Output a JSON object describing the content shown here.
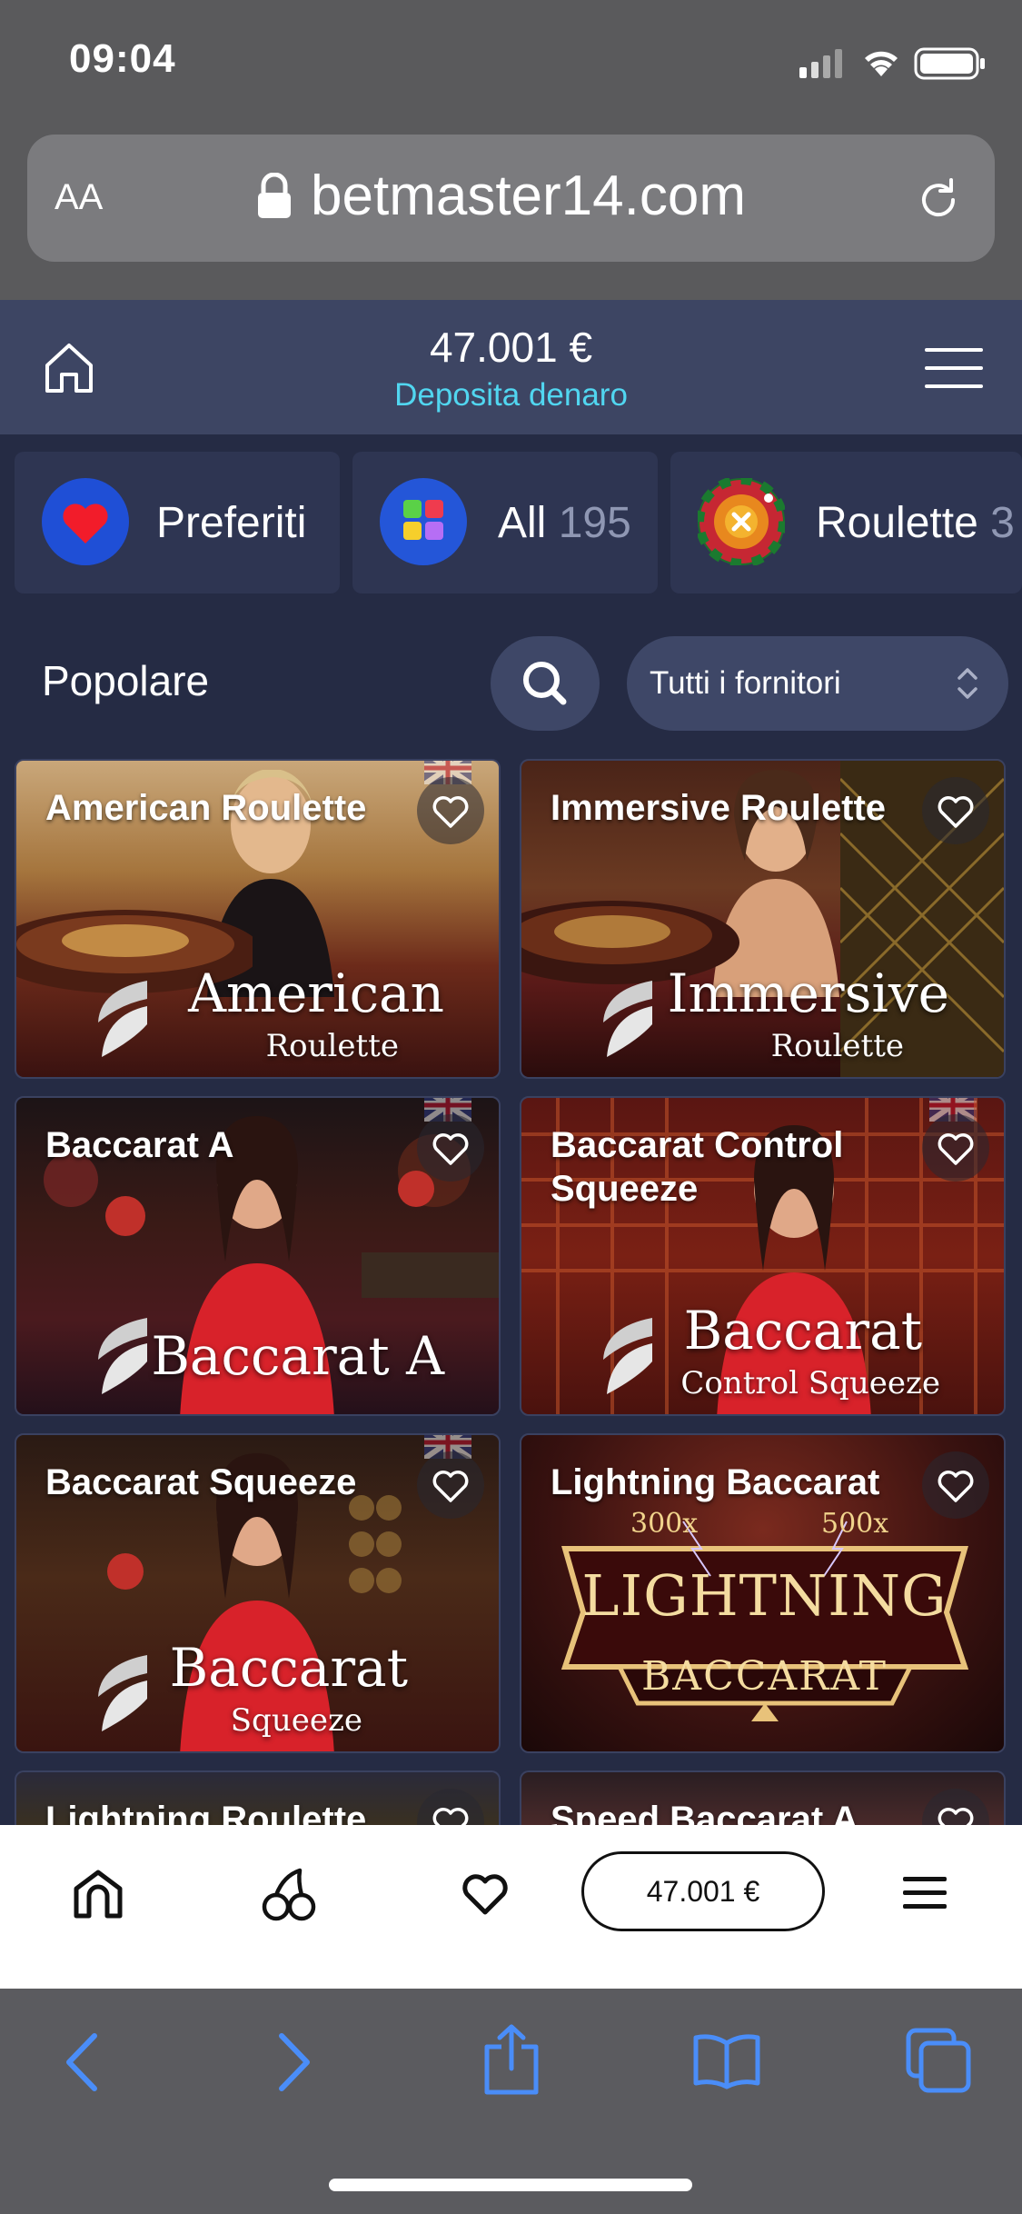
{
  "status_bar": {
    "time": "09:04"
  },
  "browser": {
    "aa_label": "AA",
    "url": "betmaster14.com"
  },
  "header": {
    "balance": "47.001 €",
    "deposit_link": "Deposita denaro"
  },
  "categories": [
    {
      "label": "Preferiti",
      "count": ""
    },
    {
      "label": "All",
      "count": "195"
    },
    {
      "label": "Roulette",
      "count": "3"
    }
  ],
  "filter": {
    "section_title": "Popolare",
    "provider_select": "Tutti i fornitori"
  },
  "games": [
    {
      "title": "American Roulette",
      "logo": "American",
      "logo_sub": "Roulette"
    },
    {
      "title": "Immersive Roulette",
      "logo": "Immersive",
      "logo_sub": "Roulette"
    },
    {
      "title": "Baccarat A",
      "logo": "Baccarat A",
      "logo_sub": ""
    },
    {
      "title": "Baccarat Control Squeeze",
      "logo": "Baccarat",
      "logo_sub": "Control Squeeze"
    },
    {
      "title": "Baccarat Squeeze",
      "logo": "Baccarat",
      "logo_sub": "Squeeze"
    },
    {
      "title": "Lightning Baccarat",
      "logo": "LIGHTNING",
      "logo_sub": "BACCARAT",
      "multiplier_left": "300x",
      "multiplier_right": "500x"
    },
    {
      "title": "Lightning Roulette"
    },
    {
      "title": "Speed Baccarat A"
    }
  ],
  "bottom_nav": {
    "balance": "47.001 €"
  },
  "colors": {
    "accent": "#51d6f0",
    "header_bg": "#3d4563",
    "page_bg": "#252b44",
    "safari_blue": "#4a8df8"
  }
}
